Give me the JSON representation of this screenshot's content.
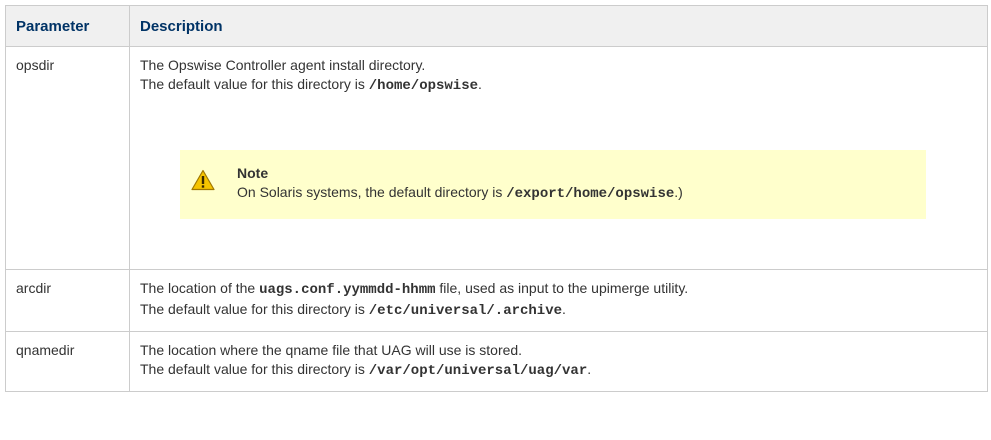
{
  "table": {
    "headers": {
      "parameter": "Parameter",
      "description": "Description"
    },
    "rows": [
      {
        "parameter": "opsdir",
        "line1": "The Opswise Controller agent install directory.",
        "line2_prefix": "The default value for this directory is ",
        "line2_code": "/home/opswise",
        "line2_suffix": ".",
        "note": {
          "icon": "warning-icon",
          "title": "Note",
          "text_prefix": "On Solaris systems, the default directory is ",
          "text_code": "/export/home/opswise",
          "text_suffix": ".)"
        }
      },
      {
        "parameter": "arcdir",
        "line1_prefix": "The location of the ",
        "line1_code": "uags.conf.yymmdd-hhmm",
        "line1_suffix": " file, used as input to the upimerge utility.",
        "line2_prefix": "The default value for this directory is ",
        "line2_code": "/etc/universal/.archive",
        "line2_suffix": "."
      },
      {
        "parameter": "qnamedir",
        "line1": "The location where the qname file that UAG will use is stored.",
        "line2_prefix": "The default value for this directory is ",
        "line2_code": "/var/opt/universal/uag/var",
        "line2_suffix": "."
      }
    ]
  },
  "colors": {
    "header_bg": "#f0f0f0",
    "header_text": "#003366",
    "note_bg": "#ffffcc",
    "border": "#cccccc"
  }
}
